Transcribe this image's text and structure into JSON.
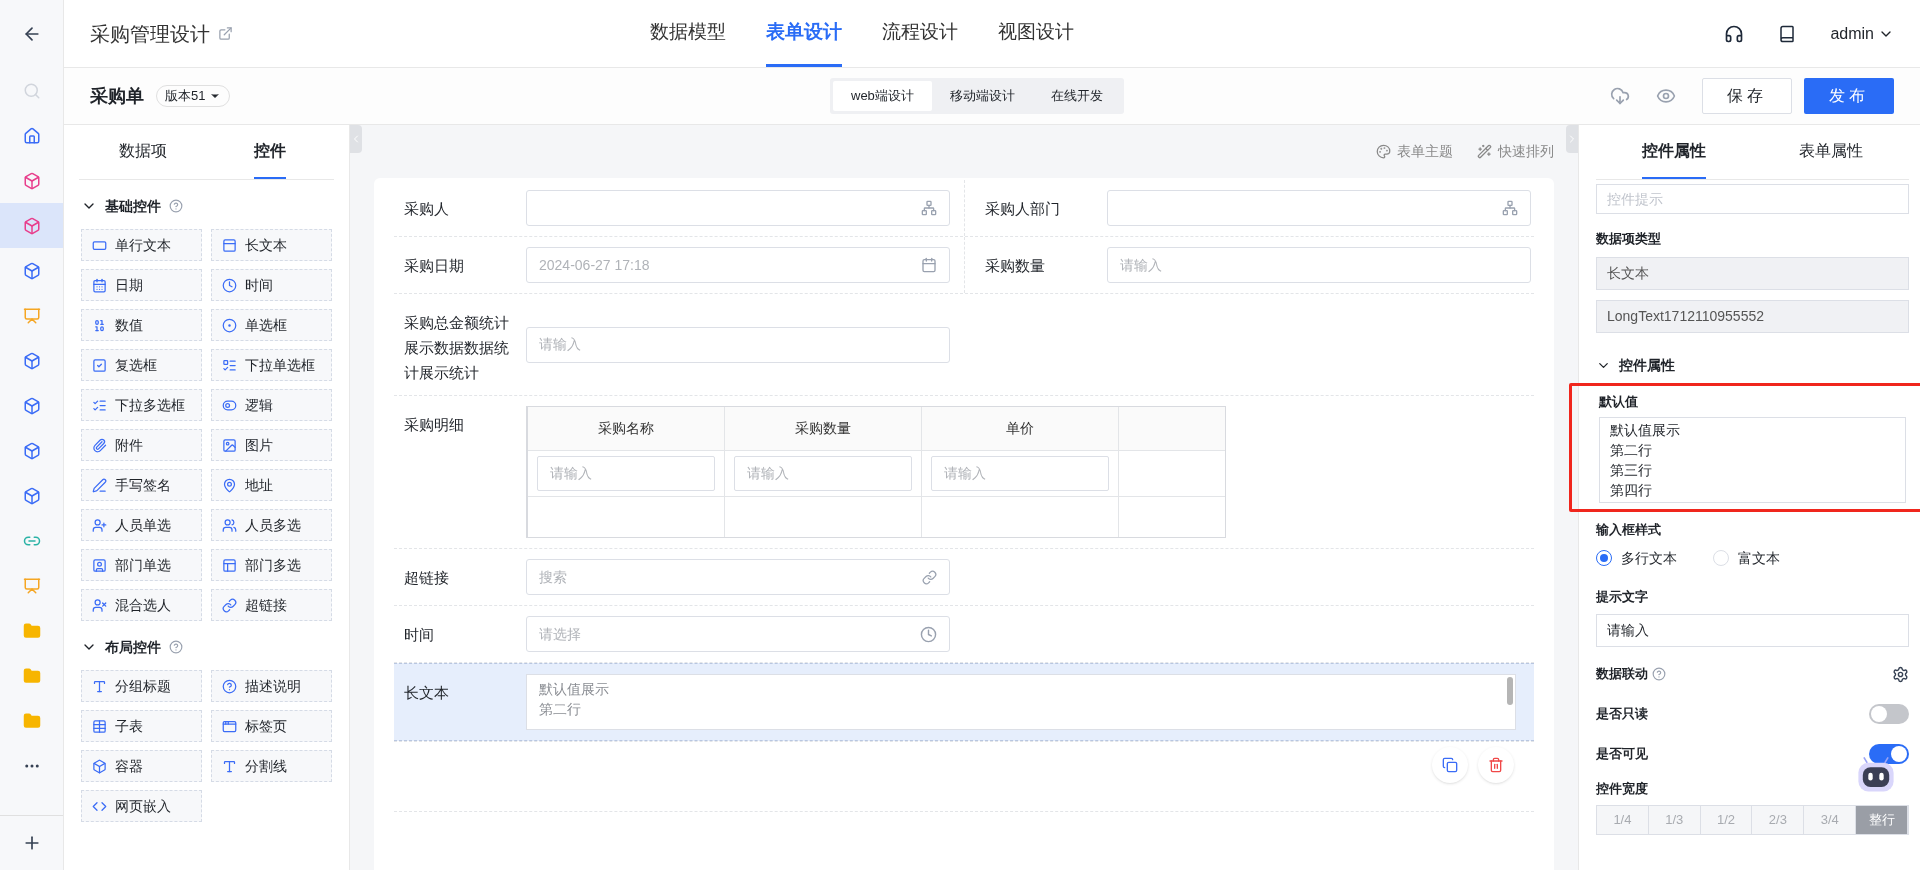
{
  "rail": {
    "items": [
      {
        "kind": "search",
        "selected": false
      },
      {
        "kind": "home",
        "selected": false
      },
      {
        "kind": "module",
        "selected": false
      },
      {
        "kind": "module",
        "selected": true
      },
      {
        "kind": "app",
        "selected": false
      },
      {
        "kind": "report",
        "selected": false
      },
      {
        "kind": "app",
        "selected": false
      },
      {
        "kind": "app",
        "selected": false
      },
      {
        "kind": "app",
        "selected": false
      },
      {
        "kind": "app",
        "selected": false
      },
      {
        "kind": "link",
        "selected": false
      },
      {
        "kind": "report",
        "selected": false
      },
      {
        "kind": "folder",
        "selected": false
      },
      {
        "kind": "folder",
        "selected": false
      },
      {
        "kind": "folder",
        "selected": false
      },
      {
        "kind": "more",
        "selected": false
      }
    ]
  },
  "header": {
    "title": "采购管理设计",
    "nav": [
      {
        "label": "数据模型",
        "selected": false
      },
      {
        "label": "表单设计",
        "selected": true
      },
      {
        "label": "流程设计",
        "selected": false
      },
      {
        "label": "视图设计",
        "selected": false
      }
    ],
    "user": "admin"
  },
  "subheader": {
    "form_name": "采购单",
    "version": "版本51",
    "modes": [
      {
        "label": "web端设计",
        "selected": true
      },
      {
        "label": "移动端设计",
        "selected": false
      },
      {
        "label": "在线开发",
        "selected": false
      }
    ],
    "save": "保存",
    "publish": "发布"
  },
  "left_panel": {
    "tabs": [
      {
        "label": "数据项",
        "selected": false
      },
      {
        "label": "控件",
        "selected": true
      }
    ],
    "sections": [
      {
        "title": "基础控件",
        "expanded": true,
        "items": [
          {
            "label": "单行文本",
            "kind": "text"
          },
          {
            "label": "长文本",
            "kind": "textarea"
          },
          {
            "label": "日期",
            "kind": "date"
          },
          {
            "label": "时间",
            "kind": "time"
          },
          {
            "label": "数值",
            "kind": "number"
          },
          {
            "label": "单选框",
            "kind": "radio"
          },
          {
            "label": "复选框",
            "kind": "checkbox"
          },
          {
            "label": "下拉单选框",
            "kind": "select"
          },
          {
            "label": "下拉多选框",
            "kind": "multiselect"
          },
          {
            "label": "逻辑",
            "kind": "switch"
          },
          {
            "label": "附件",
            "kind": "attachment"
          },
          {
            "label": "图片",
            "kind": "image"
          },
          {
            "label": "手写签名",
            "kind": "signature"
          },
          {
            "label": "地址",
            "kind": "address"
          },
          {
            "label": "人员单选",
            "kind": "user"
          },
          {
            "label": "人员多选",
            "kind": "users"
          },
          {
            "label": "部门单选",
            "kind": "dept"
          },
          {
            "label": "部门多选",
            "kind": "depts"
          },
          {
            "label": "混合选人",
            "kind": "mixed"
          },
          {
            "label": "超链接",
            "kind": "link"
          }
        ]
      },
      {
        "title": "布局控件",
        "expanded": true,
        "items": [
          {
            "label": "分组标题",
            "kind": "heading"
          },
          {
            "label": "描述说明",
            "kind": "help"
          },
          {
            "label": "子表",
            "kind": "table"
          },
          {
            "label": "标签页",
            "kind": "tabs"
          },
          {
            "label": "容器",
            "kind": "container"
          },
          {
            "label": "分割线",
            "kind": "divider"
          },
          {
            "label": "网页嵌入",
            "kind": "embed"
          }
        ]
      }
    ]
  },
  "canvas": {
    "toolbar": [
      "表单主题",
      "快速排列"
    ],
    "rows": [
      {
        "fields": [
          {
            "label": "采购人",
            "kind": "user",
            "selected": false
          },
          {
            "label": "采购人部门",
            "kind": "user",
            "selected": false
          }
        ]
      },
      {
        "fields": [
          {
            "label": "采购日期",
            "kind": "date",
            "placeholder": "2024-06-27 17:18",
            "selected": false
          },
          {
            "label": "采购数量",
            "kind": "text",
            "placeholder": "请输入",
            "selected": false
          }
        ]
      },
      {
        "fields": [
          {
            "label": "采购总金额统计展示数据数据统计展示统计",
            "kind": "text",
            "placeholder": "请输入",
            "selected": false
          }
        ]
      },
      {
        "fields": [
          {
            "label": "采购明细",
            "kind": "subtable",
            "columns": [
              "采购名称",
              "采购数量",
              "单价"
            ],
            "cells": [
              "请输入",
              "请输入",
              "请输入"
            ],
            "selected": false
          }
        ]
      },
      {
        "fields": [
          {
            "label": "超链接",
            "kind": "link",
            "placeholder": "搜索",
            "selected": false
          }
        ]
      },
      {
        "fields": [
          {
            "label": "时间",
            "kind": "time",
            "placeholder": "请选择",
            "selected": false
          }
        ]
      },
      {
        "fields": [
          {
            "label": "长文本",
            "kind": "textarea",
            "lines": [
              "默认值展示",
              "第二行"
            ],
            "selected": true
          }
        ]
      }
    ]
  },
  "right_panel": {
    "tabs": [
      {
        "label": "控件属性",
        "selected": true
      },
      {
        "label": "表单属性",
        "selected": false
      }
    ],
    "hint_field": {
      "placeholder": "控件提示"
    },
    "type_label": "数据项类型",
    "type_value": "长文本",
    "field_id": "LongText1712110955552",
    "section": {
      "title": "控件属性",
      "expanded": true
    },
    "default_value": {
      "label": "默认值",
      "lines": [
        "默认值展示",
        "第二行",
        "第三行",
        "第四行"
      ],
      "highlighted": true
    },
    "input_style": {
      "label": "输入框样式",
      "options": [
        {
          "label": "多行文本",
          "selected": true
        },
        {
          "label": "富文本",
          "selected": false
        }
      ]
    },
    "placeholder_text": {
      "label": "提示文字",
      "value": "请输入"
    },
    "linkage": "数据联动",
    "switches": [
      {
        "label": "是否只读",
        "on": false
      },
      {
        "label": "是否可见",
        "on": true
      }
    ],
    "width": {
      "label": "控件宽度",
      "options": [
        {
          "label": "1/4",
          "selected": false
        },
        {
          "label": "1/3",
          "selected": false
        },
        {
          "label": "1/2",
          "selected": false
        },
        {
          "label": "2/3",
          "selected": false
        },
        {
          "label": "3/4",
          "selected": false
        },
        {
          "label": "整行",
          "selected": true
        }
      ]
    }
  }
}
